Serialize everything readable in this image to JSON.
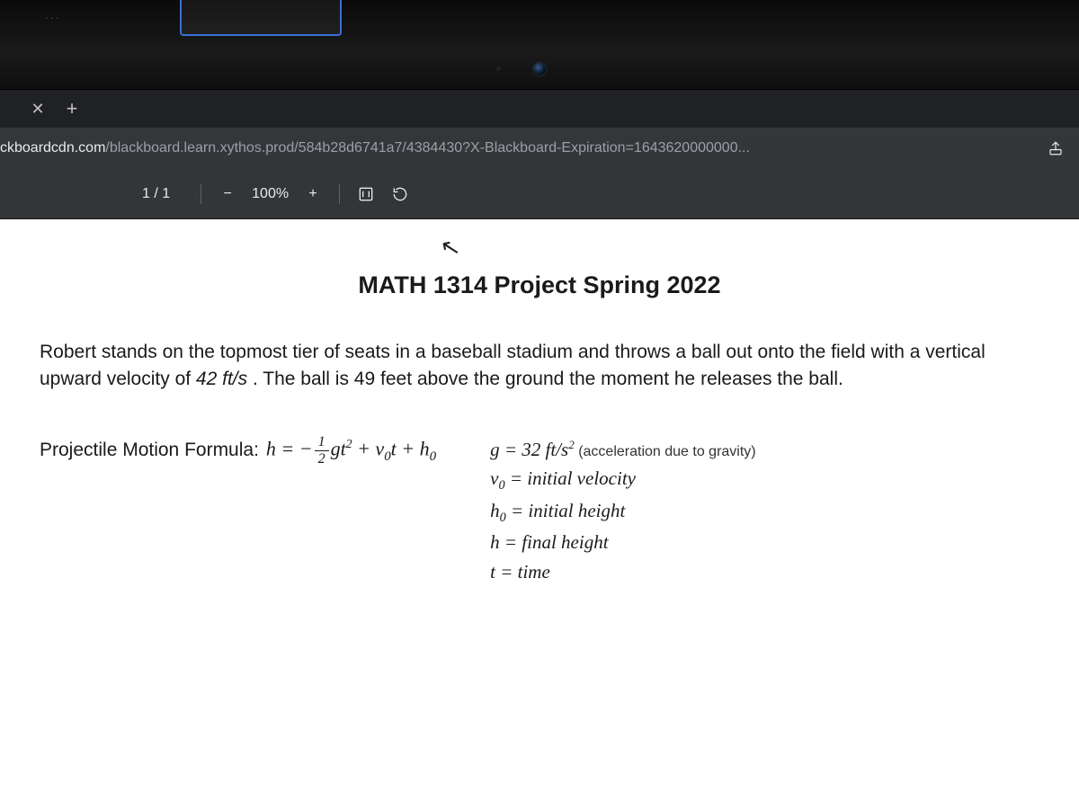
{
  "bezel": {
    "dots": "..."
  },
  "tabstrip": {
    "close_glyph": "✕",
    "newtab_glyph": "+"
  },
  "url": {
    "domain": "ckboardcdn.com",
    "path": "/blackboard.learn.xythos.prod/584b28d6741a7/4384430?X-Blackboard-Expiration=1643620000000..."
  },
  "pdf_toolbar": {
    "page_indicator": "1 / 1",
    "zoom_minus": "−",
    "zoom_level": "100%",
    "zoom_plus": "+"
  },
  "document": {
    "title": "MATH 1314 Project Spring 2022",
    "problem_text_1": "Robert stands on the topmost tier of seats in a baseball stadium and throws a ball out onto the field with a vertical upward velocity of ",
    "velocity": "42 ft/s",
    "problem_text_2": ".  The ball is 49 feet above the ground the moment he releases the ball.",
    "formula_label": "Projectile Motion Formula:",
    "formula_lhs": "h = −",
    "formula_frac_num": "1",
    "formula_frac_den": "2",
    "formula_g": "g",
    "formula_t2": "t",
    "formula_sup2": "2",
    "formula_plus1": " + v",
    "formula_v0sub": "0",
    "formula_t": "t + h",
    "formula_h0sub": "0",
    "defs": {
      "g_line_a": "g = 32 ft/s",
      "g_line_sup": "2",
      "g_note": "  (acceleration due to gravity)",
      "v0_a": "v",
      "v0_sub": "0",
      "v0_b": " = initial velocity",
      "h0_a": "h",
      "h0_sub": "0",
      "h0_b": " = initial height",
      "h_line": "h = final height",
      "t_line": "t = time"
    }
  }
}
